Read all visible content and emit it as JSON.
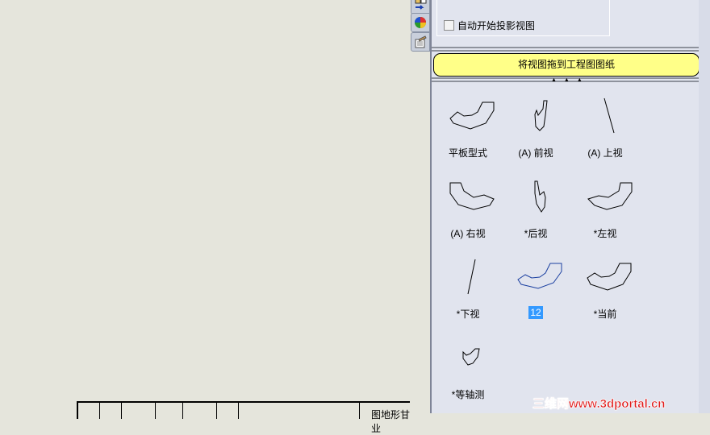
{
  "options": {
    "auto_projected_view_label": "自动开始投影视图",
    "auto_projected_view_checked": false
  },
  "drag_hint": "将视图拖到工程图图纸",
  "views": [
    {
      "label": "平板型式"
    },
    {
      "label": "(A) 前视"
    },
    {
      "label": "(A) 上视"
    },
    {
      "label": "(A) 右视"
    },
    {
      "label": "*后视"
    },
    {
      "label": "*左视"
    },
    {
      "label": "*下视"
    },
    {
      "label": "12",
      "selected": true
    },
    {
      "label": "*当前"
    },
    {
      "label": "*等轴测"
    }
  ],
  "title_block": {
    "partial_text": "图地形甘业"
  },
  "watermark": "三维网www.3dportal.cn",
  "colors": {
    "hint_bg": "#ffff88",
    "selection": "#3399ff",
    "watermark": "#e01818"
  }
}
